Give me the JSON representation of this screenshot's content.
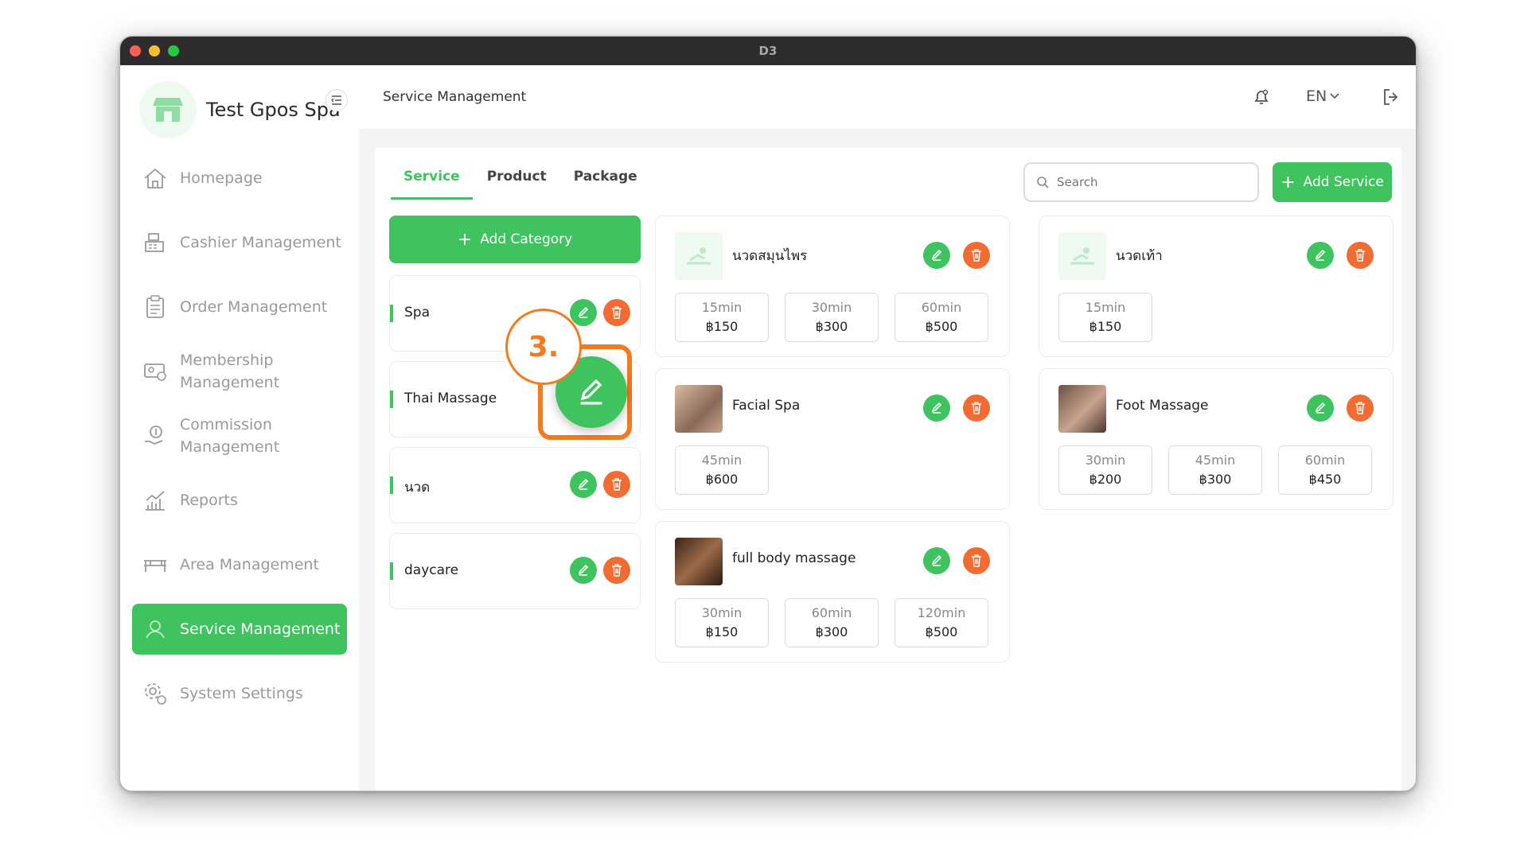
{
  "window": {
    "title": "D3"
  },
  "brand": {
    "name": "Test Gpos Spa"
  },
  "sidebar": {
    "items": [
      {
        "label": "Homepage",
        "icon": "home-icon"
      },
      {
        "label": "Cashier Management",
        "icon": "cash-register-icon"
      },
      {
        "label": "Order Management",
        "icon": "clipboard-icon"
      },
      {
        "label": "Membership Management",
        "icon": "member-card-icon"
      },
      {
        "label": "Commission Management",
        "icon": "money-hand-icon"
      },
      {
        "label": "Reports",
        "icon": "chart-icon"
      },
      {
        "label": "Area Management",
        "icon": "bed-icon"
      },
      {
        "label": "Service Management",
        "icon": "service-icon",
        "active": true
      },
      {
        "label": "System Settings",
        "icon": "gear-icon"
      }
    ]
  },
  "header": {
    "page_title": "Service Management",
    "language": "EN"
  },
  "tabs": [
    {
      "label": "Service",
      "active": true
    },
    {
      "label": "Product"
    },
    {
      "label": "Package"
    }
  ],
  "search": {
    "placeholder": "Search"
  },
  "actions": {
    "add_service": "Add Service",
    "add_category": "Add Category"
  },
  "categories": [
    {
      "name": "Spa"
    },
    {
      "name": "Thai Massage"
    },
    {
      "name": "นวด"
    },
    {
      "name": "daycare"
    }
  ],
  "services": [
    {
      "name": "นวดสมุนไพร",
      "prices": [
        {
          "duration": "15min",
          "price": "฿150"
        },
        {
          "duration": "30min",
          "price": "฿300"
        },
        {
          "duration": "60min",
          "price": "฿500"
        }
      ]
    },
    {
      "name": "นวดเท้า",
      "prices": [
        {
          "duration": "15min",
          "price": "฿150"
        }
      ]
    },
    {
      "name": "Facial Spa",
      "prices": [
        {
          "duration": "45min",
          "price": "฿600"
        }
      ]
    },
    {
      "name": "Foot Massage",
      "prices": [
        {
          "duration": "30min",
          "price": "฿200"
        },
        {
          "duration": "45min",
          "price": "฿300"
        },
        {
          "duration": "60min",
          "price": "฿450"
        }
      ]
    },
    {
      "name": "full body massage",
      "prices": [
        {
          "duration": "30min",
          "price": "฿150"
        },
        {
          "duration": "60min",
          "price": "฿300"
        },
        {
          "duration": "120min",
          "price": "฿500"
        }
      ]
    }
  ],
  "annotation": {
    "step": "3."
  },
  "colors": {
    "primary": "#3ec35f",
    "danger": "#f26b30",
    "callout": "#f47a20"
  }
}
